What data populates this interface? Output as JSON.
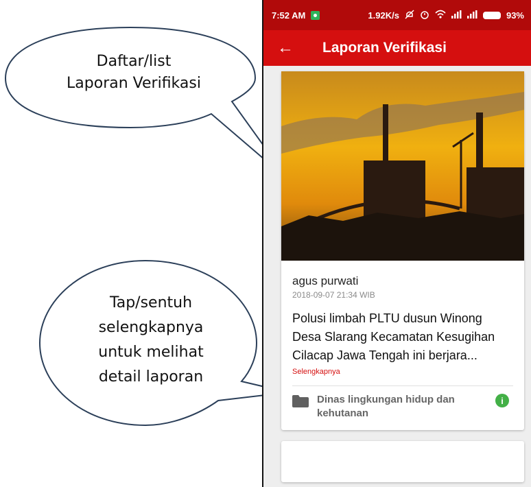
{
  "callouts": {
    "list_note_line1": "Daftar/list",
    "list_note_line2": "Laporan Verifikasi",
    "detail_note_line1": "Tap/sentuh",
    "detail_note_line2": "selengkapnya",
    "detail_note_line3": "untuk melihat",
    "detail_note_line4": "detail laporan"
  },
  "statusbar": {
    "time": "7:52 AM",
    "network_speed": "1.92K/s",
    "battery": "93%"
  },
  "appbar": {
    "title": "Laporan Verifikasi",
    "back_icon": "arrow-left-icon"
  },
  "report_card": {
    "reporter": "agus purwati",
    "timestamp": "2018-09-07 21:34 WIB",
    "text": "Polusi limbah PLTU dusun Winong Desa Slarang  Kecamatan Kesugihan  Cilacap  Jawa Tengah ini berjara...",
    "more_link": "Selengkapnya",
    "agency": "Dinas lingkungan hidup dan kehutanan",
    "agency_icon": "folder-icon",
    "info_icon": "info-icon"
  },
  "colors": {
    "statusbar": "#b10a0a",
    "appbar": "#d50f0f",
    "link": "#d50f0f",
    "info": "#43b047"
  }
}
